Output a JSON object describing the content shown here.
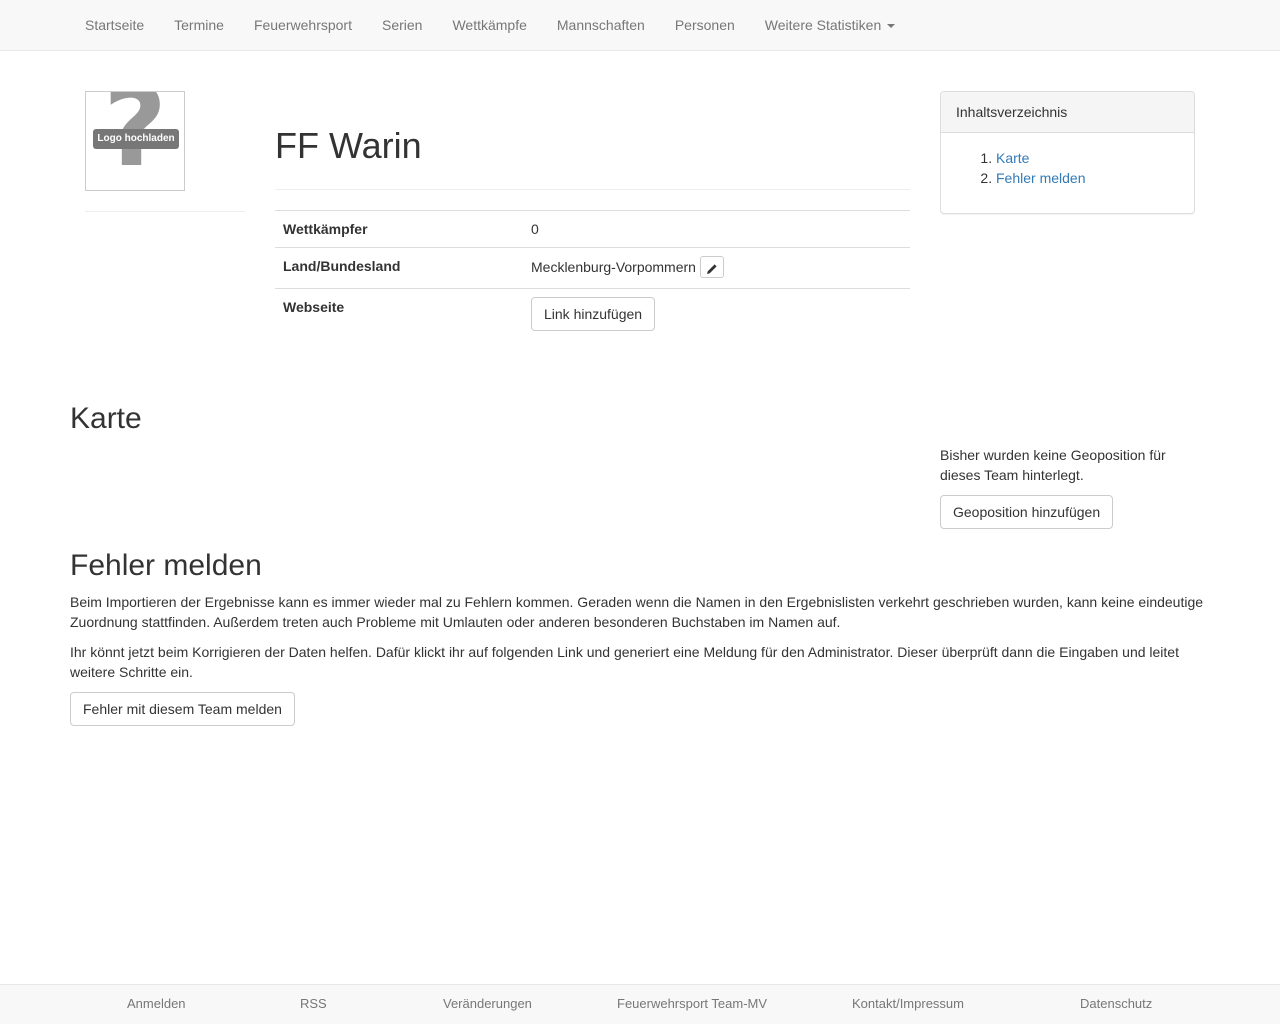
{
  "nav": {
    "items": [
      "Startseite",
      "Termine",
      "Feuerwehrsport",
      "Serien",
      "Wettkämpfe",
      "Mannschaften",
      "Personen"
    ],
    "dropdown": "Weitere Statistiken"
  },
  "logo": {
    "upload_label": "Logo hochladen"
  },
  "team": {
    "title": "FF Warin",
    "rows": {
      "competitors": {
        "label": "Wettkämpfer",
        "value": "0"
      },
      "state": {
        "label": "Land/Bundesland",
        "value": "Mecklenburg-Vorpommern"
      },
      "website": {
        "label": "Webseite",
        "button": "Link hinzufügen"
      }
    }
  },
  "toc": {
    "heading": "Inhaltsverzeichnis",
    "items": [
      "Karte",
      "Fehler melden"
    ]
  },
  "map": {
    "heading": "Karte",
    "no_geo_text": "Bisher wurden keine Geoposition für dieses Team hinterlegt.",
    "add_geo_button": "Geoposition hinzufügen"
  },
  "report": {
    "heading": "Fehler melden",
    "paragraph1": "Beim Importieren der Ergebnisse kann es immer wieder mal zu Fehlern kommen. Geraden wenn die Namen in den Ergebnislisten verkehrt geschrieben wurden, kann keine eindeutige Zuordnung stattfinden. Außerdem treten auch Probleme mit Umlauten oder anderen besonderen Buchstaben im Namen auf.",
    "paragraph2": "Ihr könnt jetzt beim Korrigieren der Daten helfen. Dafür klickt ihr auf folgenden Link und generiert eine Meldung für den Administrator. Dieser überprüft dann die Eingaben und leitet weitere Schritte ein.",
    "button": "Fehler mit diesem Team melden"
  },
  "footer": {
    "links": [
      "Anmelden",
      "RSS",
      "Veränderungen",
      "Feuerwehrsport Team-MV",
      "Kontakt/Impressum",
      "Datenschutz"
    ]
  },
  "colors": {
    "link": "#337ab7",
    "nav_text": "#777777",
    "navbar_bg": "#f8f8f8"
  },
  "icons": {
    "edit": "pencil-icon",
    "logo_placeholder": "question-mark-icon",
    "dropdown": "caret-down-icon"
  }
}
